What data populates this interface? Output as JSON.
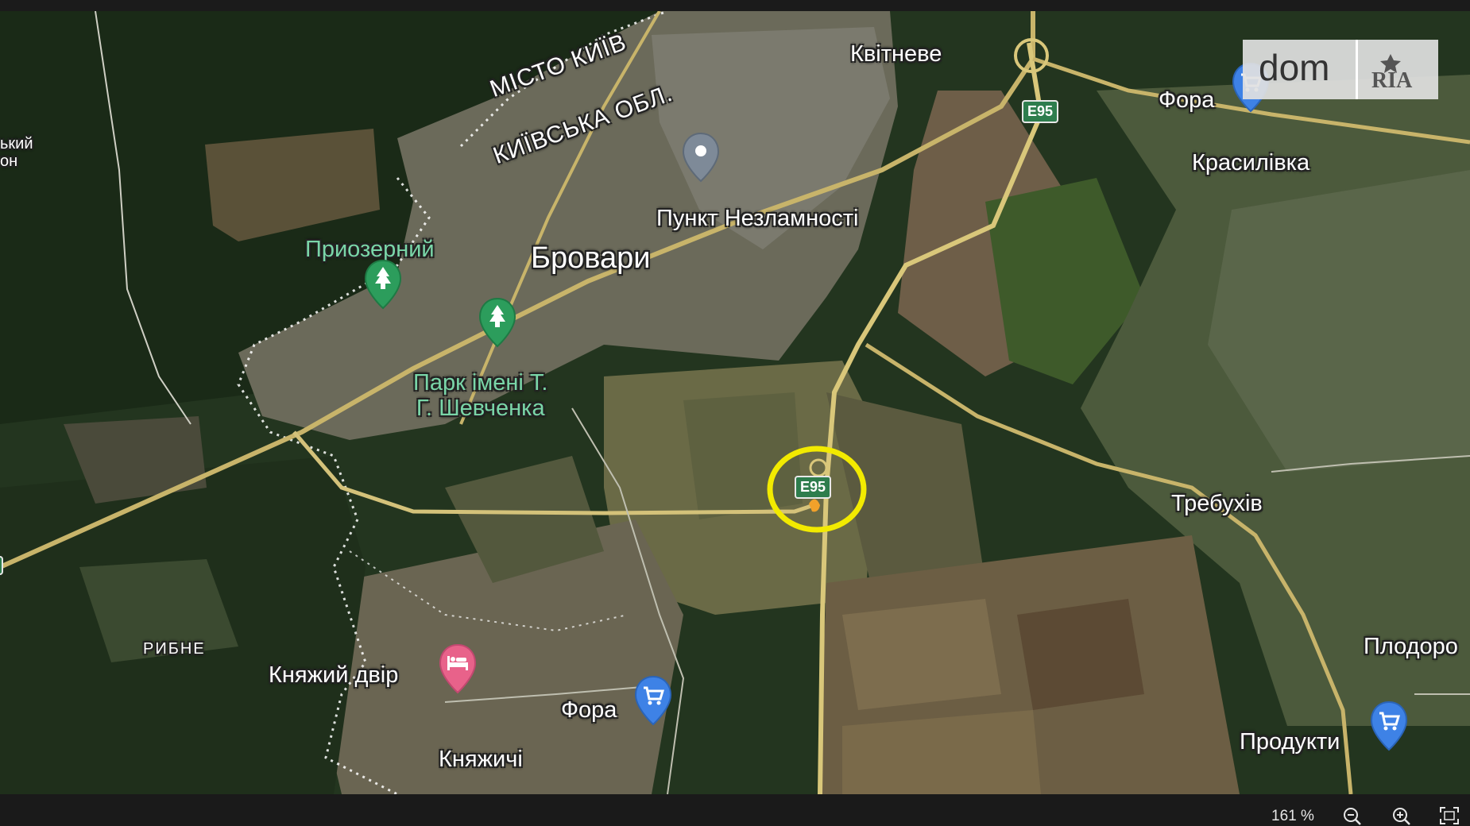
{
  "logo": {
    "text": "dom",
    "badge": "RIA"
  },
  "labels": {
    "kyiv_city": "МІСТО КИЇВ",
    "kyiv_oblast": "КИЇВСЬКА ОБЛ.",
    "kvitneve": "Квітневе",
    "fora_ne": "Фора",
    "krasylivka": "Красилівка",
    "punkt": "Пункт Незламності",
    "pryozernyi": "Приозерний",
    "brovary": "Бровари",
    "park_line1": "Парк імені Т.",
    "park_line2": "Г. Шевченка",
    "trebukhiv": "Требухів",
    "rybne": "РИБНЕ",
    "knyazhyi_dvir": "Княжий двір",
    "fora_s": "Фора",
    "knyazhychi": "Княжичі",
    "plodorodne": "Плодоро",
    "produkty": "Продукти",
    "edge_label1": "ький",
    "edge_label2": "он"
  },
  "road_shields": [
    "E95",
    "E95"
  ],
  "highlight": {
    "color": "#f2ea00"
  },
  "zoom": {
    "level": "161 %"
  },
  "icons": [
    "zoom-out-icon",
    "zoom-in-icon",
    "fullscreen-icon",
    "tree-icon",
    "shopping-cart-icon",
    "hotel-bed-icon",
    "location-pin-icon"
  ]
}
